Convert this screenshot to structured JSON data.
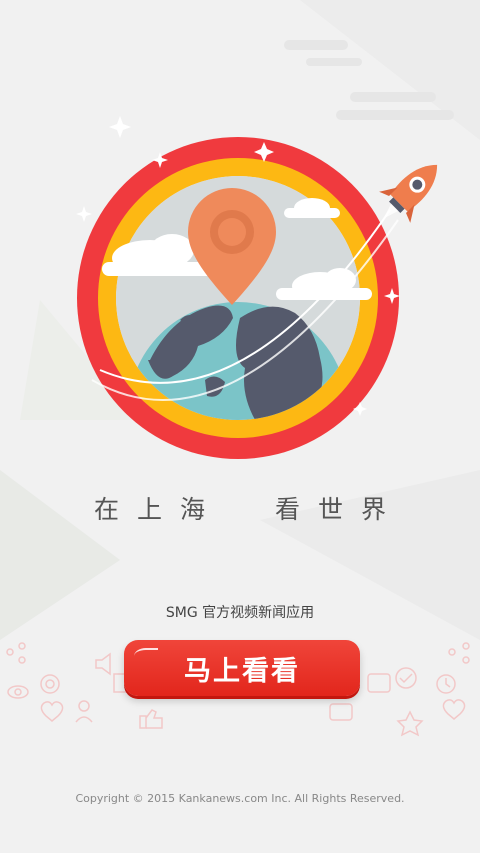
{
  "splash": {
    "slogan": "在上海  看世界",
    "subtitle": "SMG 官方视频新闻应用",
    "cta_label": "马上看看",
    "copyright": "Copyright © 2015 Kankanews.com Inc. All Rights Reserved."
  },
  "icons": {
    "hero": "globe-location-pin-icon",
    "rocket": "rocket-icon",
    "background_decor": [
      "eye-icon",
      "gear-icon",
      "heart-icon",
      "user-icon",
      "share-icon",
      "like-icon",
      "sound-icon",
      "book-icon",
      "comment-icon",
      "star-icon"
    ]
  },
  "colors": {
    "outer_ring": "#f03a3e",
    "inner_ring": "#fdb813",
    "pin": "#ef8a5b",
    "globe_ocean": "#7bc4c8",
    "globe_land": "#555a6c",
    "button": "#e8281f",
    "background": "#f1f1f1"
  }
}
